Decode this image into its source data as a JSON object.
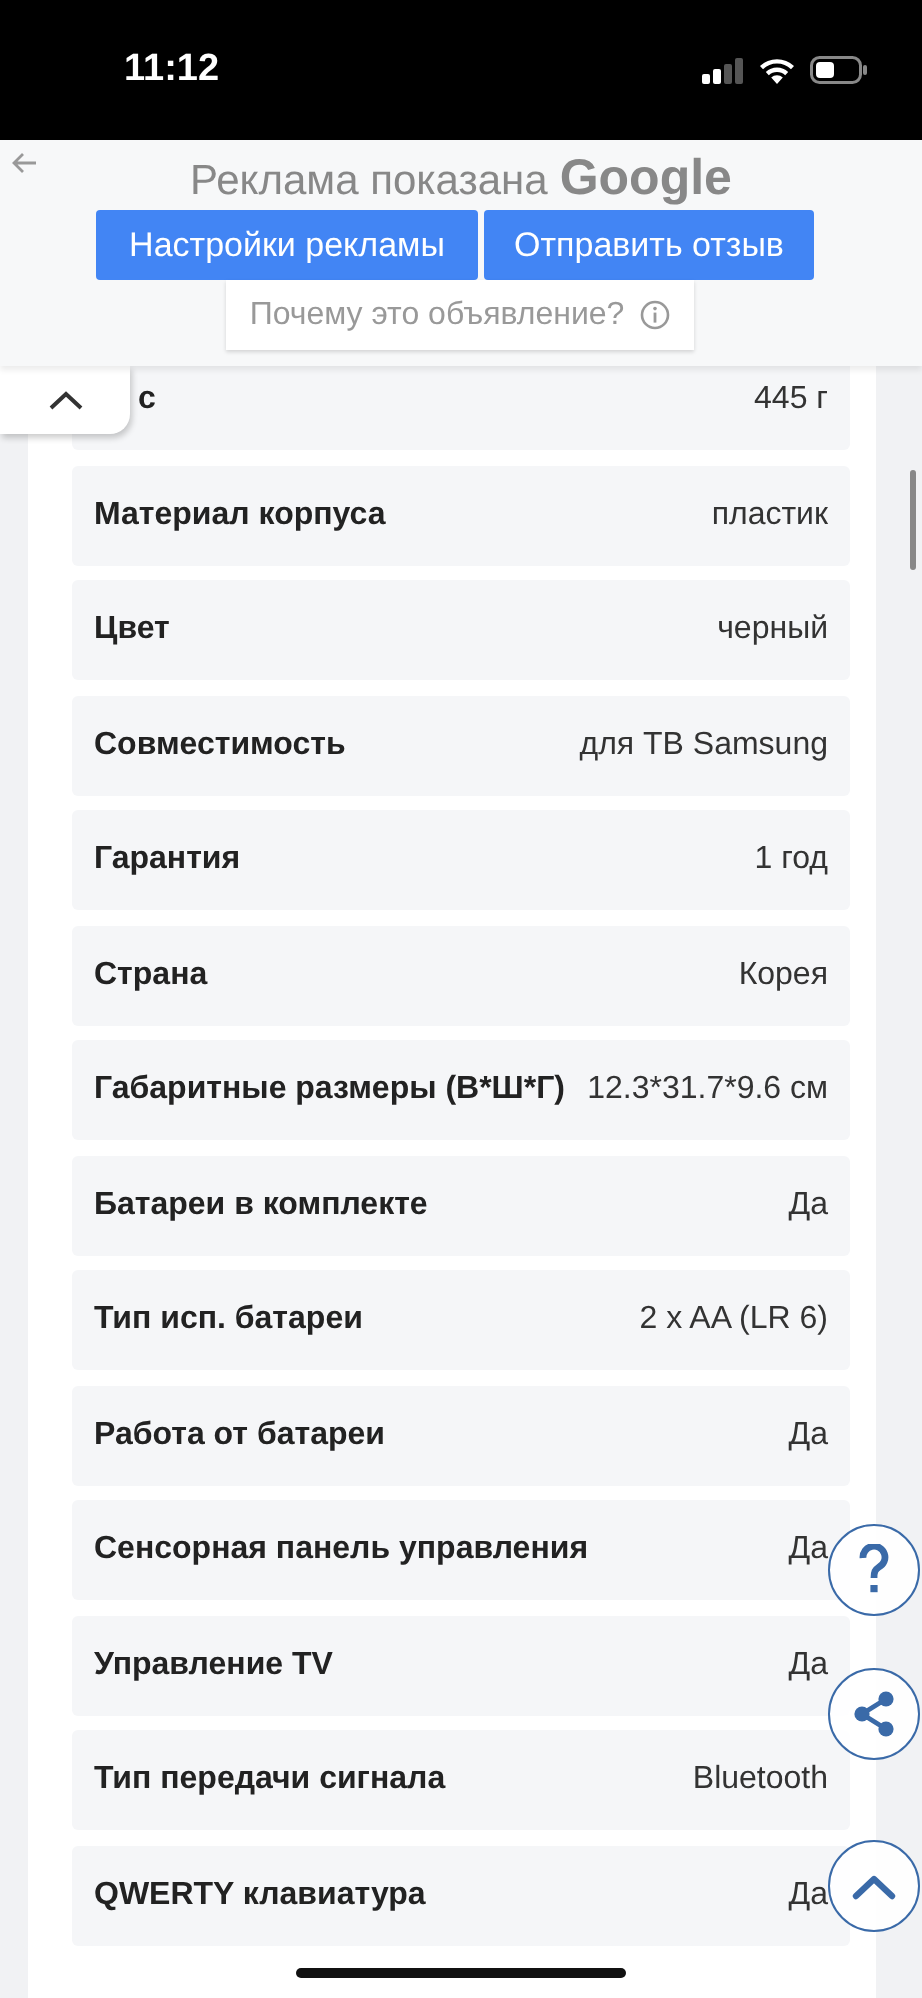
{
  "status_bar": {
    "time": "11:12"
  },
  "ad_banner": {
    "title": "Реклама показана",
    "brand": "Google",
    "buttons": [
      "Настройки рекламы",
      "Отправить отзыв"
    ],
    "why_link": "Почему это объявление?"
  },
  "specs": [
    {
      "label": "с",
      "value": "445 г"
    },
    {
      "label": "Материал корпуса",
      "value": "пластик"
    },
    {
      "label": "Цвет",
      "value": "черный"
    },
    {
      "label": "Совместимость",
      "value": "для ТВ Samsung"
    },
    {
      "label": "Гарантия",
      "value": "1 год"
    },
    {
      "label": "Страна",
      "value": "Корея"
    },
    {
      "label": "Габаритные размеры (В*Ш*Г)",
      "value": "12.3*31.7*9.6 см"
    },
    {
      "label": "Батареи в комплекте",
      "value": "Да"
    },
    {
      "label": "Тип исп. батареи",
      "value": "2 x AA (LR 6)"
    },
    {
      "label": "Работа от батареи",
      "value": "Да"
    },
    {
      "label": "Сенсорная панель управления",
      "value": "Да"
    },
    {
      "label": "Управление TV",
      "value": "Да"
    },
    {
      "label": "Тип передачи сигнала",
      "value": "Bluetooth"
    },
    {
      "label": "QWERTY клавиатура",
      "value": "Да"
    }
  ]
}
